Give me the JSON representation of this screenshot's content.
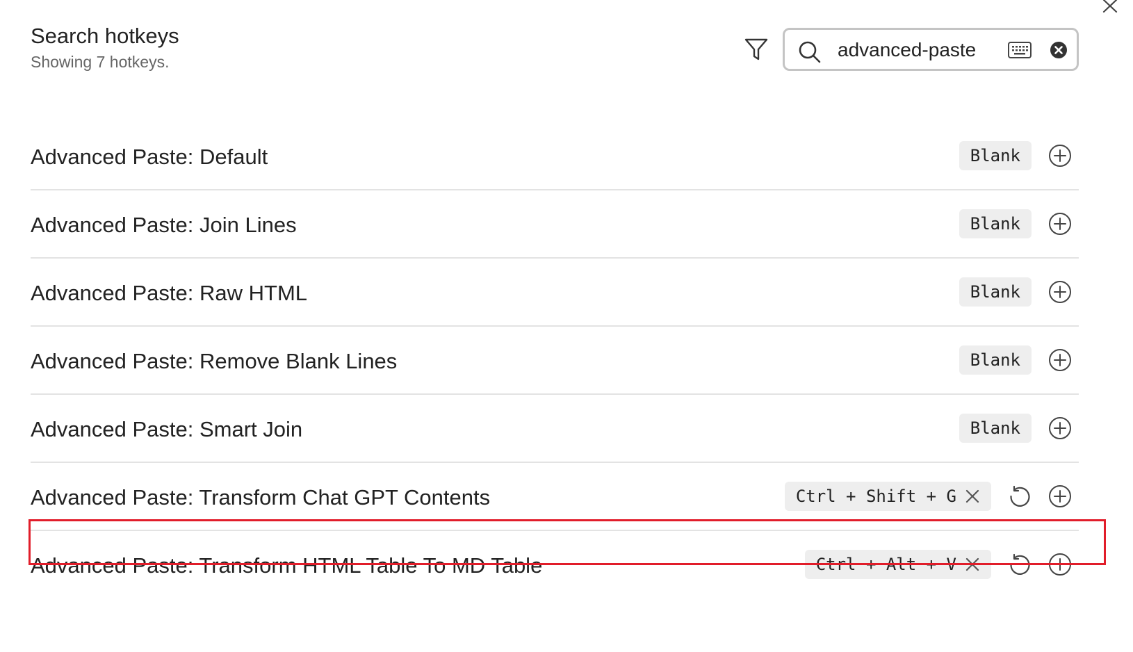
{
  "header": {
    "title": "Search hotkeys",
    "subtitle": "Showing 7 hotkeys."
  },
  "search": {
    "value": "advanced-paste",
    "icons": [
      "search-icon",
      "keyboard-icon",
      "clear-icon"
    ]
  },
  "toolbar": {
    "icons": [
      "filter-icon",
      "close-icon"
    ]
  },
  "colors": {
    "highlight": "#e11d2a",
    "chip_bg": "#eeeeee",
    "divider": "#e3e3e3"
  },
  "hotkeys": [
    {
      "label": "Advanced Paste: Default",
      "hotkey": "Blank"
    },
    {
      "label": "Advanced Paste: Join Lines",
      "hotkey": "Blank"
    },
    {
      "label": "Advanced Paste: Raw HTML",
      "hotkey": "Blank"
    },
    {
      "label": "Advanced Paste: Remove Blank Lines",
      "hotkey": "Blank"
    },
    {
      "label": "Advanced Paste: Smart Join",
      "hotkey": "Blank"
    },
    {
      "label": "Advanced Paste: Transform Chat GPT Contents",
      "hotkey": "Ctrl + Shift + G"
    },
    {
      "label": "Advanced Paste: Transform HTML Table To MD Table",
      "hotkey": "Ctrl + Alt + V"
    }
  ]
}
